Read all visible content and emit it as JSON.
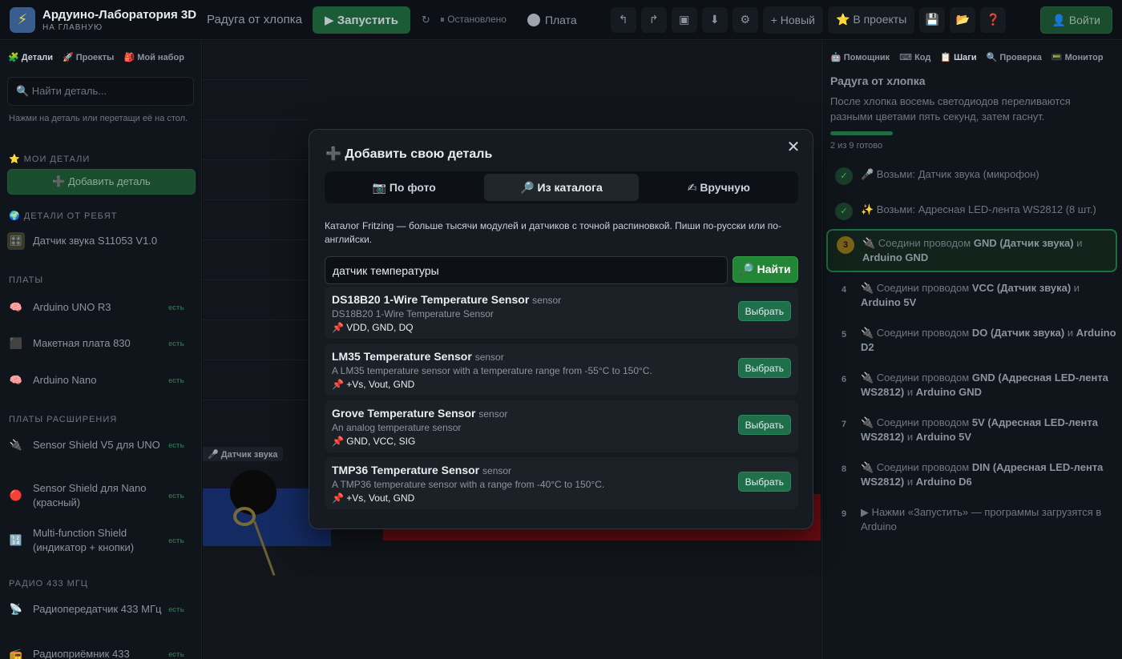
{
  "header": {
    "app_title": "Ардуино-Лаборатория 3D",
    "home_link": "НА ГЛАВНУЮ",
    "project_name": "Радуга от хлопка",
    "run_label": "▶ Запустить",
    "reset_icon": "↻",
    "status_text": "⏸ Остановлено",
    "board_label": "Плата",
    "new_label": "+ Новый",
    "to_projects_label": "⭐ В проекты",
    "login_label": "👤 Войти"
  },
  "sidebar": {
    "tabs": [
      "🧩 Детали",
      "🚀 Проекты",
      "🎒 Мой набор"
    ],
    "search_placeholder": "🔍 Найти деталь...",
    "hint": "Нажми на деталь или перетащи её на стол.",
    "sections": {
      "my_parts": "⭐ МОИ ДЕТАЛИ",
      "from_kids": "🌍 ДЕТАЛИ ОТ РЕБЯТ",
      "boards": "ПЛАТЫ",
      "shields": "ПЛАТЫ РАСШИРЕНИЯ",
      "radio": "РАДИО 433 МГЦ"
    },
    "add_part_label": "➕ Добавить деталь",
    "items": [
      {
        "label": "Датчик звука S11053 V1.0",
        "badge": ""
      },
      {
        "label": "Arduino UNO R3",
        "badge": "есть"
      },
      {
        "label": "Макетная плата 830",
        "badge": "есть"
      },
      {
        "label": "Arduino Nano",
        "badge": "есть"
      },
      {
        "label": "Sensor Shield V5 для UNO",
        "badge": "есть"
      },
      {
        "label": "Sensor Shield для Nano (красный)",
        "badge": "есть"
      },
      {
        "label": "Multi-function Shield (индикатор + кнопки)",
        "badge": "есть"
      },
      {
        "label": "Радиопередатчик 433 МГц",
        "badge": "есть"
      },
      {
        "label": "Радиоприёмник 433",
        "badge": "есть"
      }
    ]
  },
  "canvas": {
    "part_label": "🎤 Датчик звука"
  },
  "right_panel": {
    "tabs": [
      "🤖 Помощник",
      "⌨ Код",
      "📋 Шаги",
      "🔍 Проверка",
      "📟 Монитор"
    ],
    "title": "Радуга от хлопка",
    "description": "После хлопка восемь светодиодов переливаются разными цветами пять секунд, затем гаснут.",
    "progress": 0.22,
    "progress_text": "2 из 9 готово",
    "steps": [
      {
        "num": "✓",
        "state": "done",
        "html_pre": "🎤 Возьми: Датчик звука (микрофон)",
        "bold1": "",
        "mid": "",
        "bold2": ""
      },
      {
        "num": "✓",
        "state": "done",
        "html_pre": "✨ Возьми: Адресная LED-лента WS2812 (8 шт.)",
        "bold1": "",
        "mid": "",
        "bold2": ""
      },
      {
        "num": "3",
        "state": "current",
        "html_pre": "🔌 Соедини проводом ",
        "bold1": "GND (Датчик звука)",
        "mid": " и ",
        "bold2": "Arduino GND"
      },
      {
        "num": "4",
        "state": "todo",
        "html_pre": "🔌 Соедини проводом ",
        "bold1": "VCC (Датчик звука)",
        "mid": " и ",
        "bold2": "Arduino 5V"
      },
      {
        "num": "5",
        "state": "todo",
        "html_pre": "🔌 Соедини проводом ",
        "bold1": "DO (Датчик звука)",
        "mid": " и ",
        "bold2": "Arduino D2"
      },
      {
        "num": "6",
        "state": "todo",
        "html_pre": "🔌 Соедини проводом ",
        "bold1": "GND (Адресная LED-лента WS2812)",
        "mid": " и ",
        "bold2": "Arduino GND"
      },
      {
        "num": "7",
        "state": "todo",
        "html_pre": "🔌 Соедини проводом ",
        "bold1": "5V (Адресная LED-лента WS2812)",
        "mid": " и ",
        "bold2": "Arduino 5V"
      },
      {
        "num": "8",
        "state": "todo",
        "html_pre": "🔌 Соедини проводом ",
        "bold1": "DIN (Адресная LED-лента WS2812)",
        "mid": " и ",
        "bold2": "Arduino D6"
      },
      {
        "num": "9",
        "state": "todo",
        "html_pre": "▶ Нажми «Запустить» — программы загрузятся в Arduino",
        "bold1": "",
        "mid": "",
        "bold2": ""
      }
    ]
  },
  "modal": {
    "title": "➕ Добавить свою деталь",
    "close_label": "✕",
    "tabs": [
      "📷 По фото",
      "🔎 Из каталога",
      "✍ Вручную"
    ],
    "active_tab": 1,
    "description": "Каталог Fritzing — больше тысячи модулей и датчиков с точной распиновкой. Пиши по-русски или по-английски.",
    "search_value": "датчик температуры",
    "find_label": "🔎 Найти",
    "select_label": "Выбрать",
    "results": [
      {
        "name": "DS18B20 1-Wire Temperature Sensor",
        "category": "sensor",
        "description": "DS18B20 1-Wire Temperature Sensor",
        "pins": "📌 VDD, GND, DQ"
      },
      {
        "name": "LM35 Temperature Sensor",
        "category": "sensor",
        "description": "A LM35 temperature sensor with a temperature range from -55°C to 150°C.",
        "pins": "📌 +Vs, Vout, GND"
      },
      {
        "name": "Grove Temperature Sensor",
        "category": "sensor",
        "description": "An analog temperature sensor",
        "pins": "📌 GND, VCC, SIG"
      },
      {
        "name": "TMP36 Temperature Sensor",
        "category": "sensor",
        "description": "A TMP36 temperature sensor with a range from -40°C to 150°C.",
        "pins": "📌 +Vs, Vout, GND"
      }
    ]
  },
  "colors": {
    "accent_green": "#238636",
    "background": "#0d1117",
    "panel": "#161b22"
  }
}
